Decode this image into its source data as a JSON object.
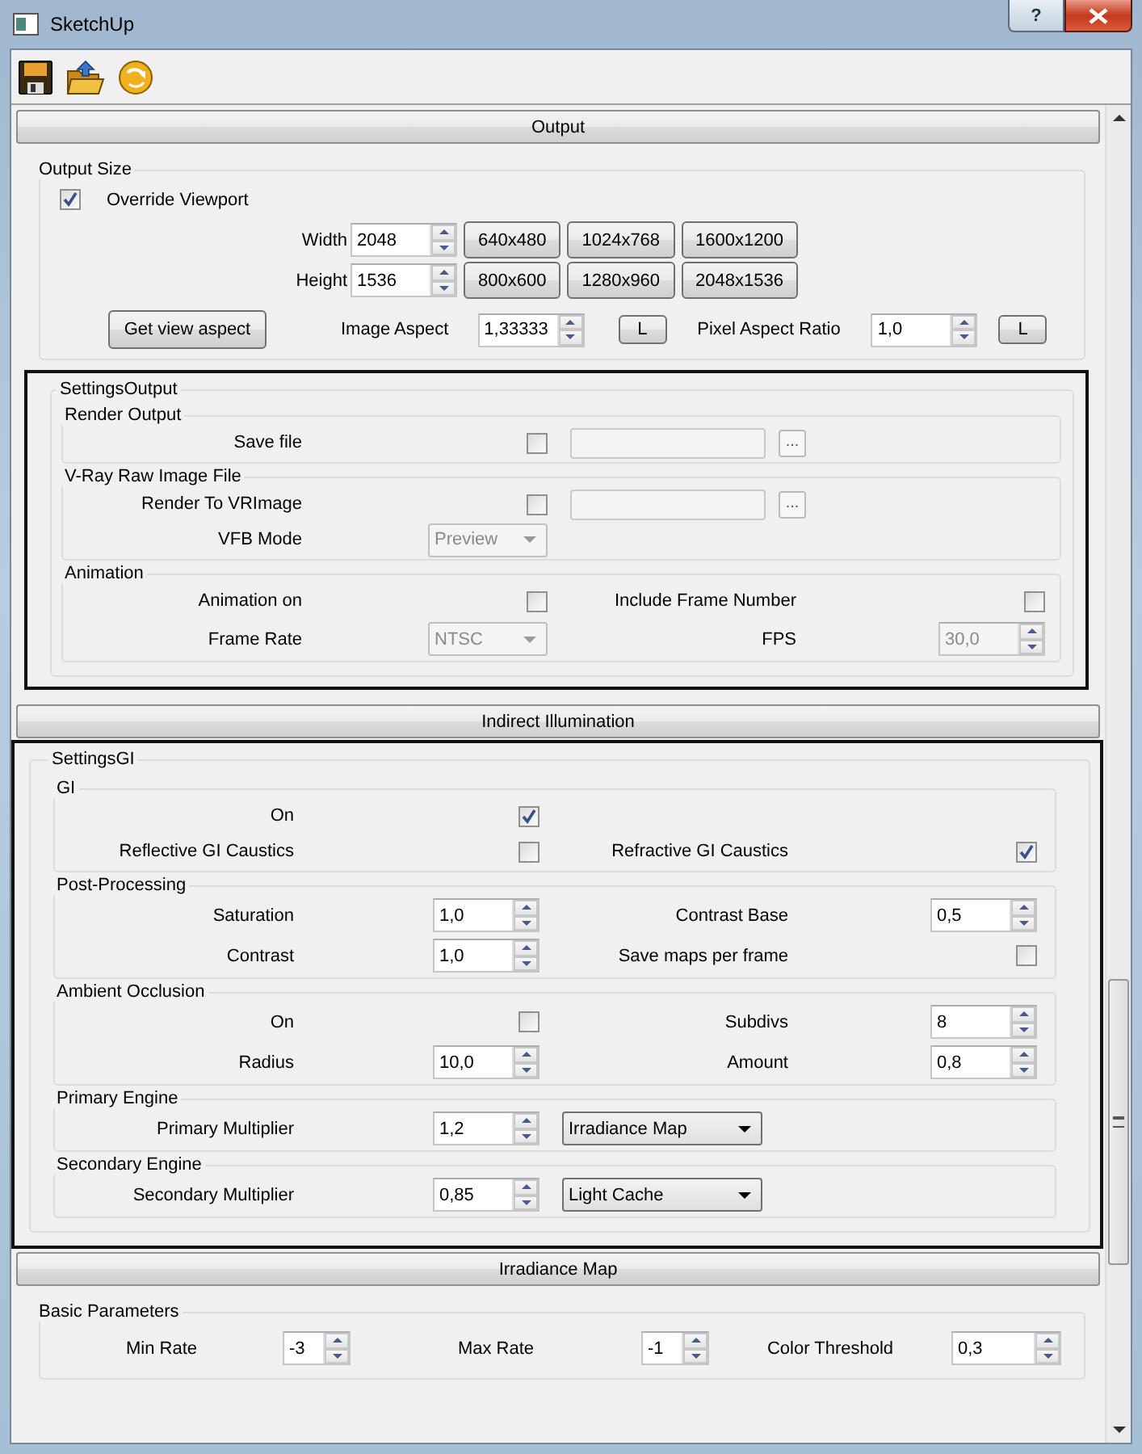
{
  "window": {
    "title": "SketchUp",
    "help_button": "?"
  },
  "toolbar": [
    {
      "kind": "save"
    },
    {
      "kind": "open"
    },
    {
      "kind": "refresh"
    }
  ],
  "sections": [
    {
      "title": "Output",
      "blocks": [
        {
          "kind": "group",
          "title": "Output Size",
          "rows": [
            {
              "kind": "check",
              "cells": [
                {
                  "kind": "checkbox",
                  "checked": true
                },
                {
                  "kind": "label",
                  "text": "Override Viewport"
                }
              ]
            },
            {
              "kind": "size",
              "cells": [
                {
                  "kind": "label",
                  "text": "Width"
                },
                {
                  "kind": "spin",
                  "value": "2048",
                  "disabled": false
                },
                {
                  "kind": "button",
                  "text": "640x480"
                },
                {
                  "kind": "button",
                  "text": "1024x768"
                },
                {
                  "kind": "button",
                  "text": "1600x1200"
                }
              ]
            },
            {
              "kind": "size",
              "cells": [
                {
                  "kind": "label",
                  "text": "Height"
                },
                {
                  "kind": "spin",
                  "value": "1536",
                  "disabled": false
                },
                {
                  "kind": "button",
                  "text": "800x600"
                },
                {
                  "kind": "button",
                  "text": "1280x960"
                },
                {
                  "kind": "button",
                  "text": "2048x1536"
                }
              ]
            },
            {
              "kind": "aspect",
              "cells": [
                {
                  "kind": "button",
                  "text": "Get view aspect"
                },
                {
                  "kind": "label",
                  "text": "Image Aspect"
                },
                {
                  "kind": "spin",
                  "value": "1,33333",
                  "disabled": false
                },
                {
                  "kind": "lock",
                  "text": "L"
                },
                {
                  "kind": "label",
                  "text": "Pixel Aspect Ratio"
                },
                {
                  "kind": "spin",
                  "value": "1,0",
                  "disabled": false
                },
                {
                  "kind": "lock",
                  "text": "L"
                }
              ]
            }
          ]
        },
        {
          "kind": "frame",
          "title": "SettingsOutput",
          "groups": [
            {
              "title": "Render Output",
              "rows": [
                {
                  "kind": "grid",
                  "cells": [
                    {
                      "kind": "label",
                      "text": "Save file"
                    },
                    {
                      "kind": "checkbox",
                      "checked": false
                    },
                    {
                      "kind": "file",
                      "browse": "..."
                    }
                  ]
                }
              ]
            },
            {
              "title": "V-Ray Raw Image File",
              "rows": [
                {
                  "kind": "grid",
                  "cells": [
                    {
                      "kind": "label",
                      "text": "Render To VRImage"
                    },
                    {
                      "kind": "checkbox",
                      "checked": false
                    },
                    {
                      "kind": "file",
                      "browse": "..."
                    }
                  ]
                },
                {
                  "kind": "grid",
                  "cells": [
                    {
                      "kind": "label",
                      "text": "VFB Mode"
                    },
                    {
                      "kind": "combo",
                      "value": "Preview",
                      "disabled": true
                    }
                  ]
                }
              ]
            },
            {
              "title": "Animation",
              "rows": [
                {
                  "kind": "grid",
                  "cells": [
                    {
                      "kind": "label",
                      "text": "Animation on"
                    },
                    {
                      "kind": "checkbox",
                      "checked": false
                    },
                    {
                      "kind": "label",
                      "text": "Include Frame Number"
                    },
                    {
                      "kind": "checkbox",
                      "checked": false
                    }
                  ]
                },
                {
                  "kind": "grid",
                  "cells": [
                    {
                      "kind": "label",
                      "text": "Frame Rate"
                    },
                    {
                      "kind": "combo",
                      "value": "NTSC",
                      "disabled": true
                    },
                    {
                      "kind": "label",
                      "text": "FPS"
                    },
                    {
                      "kind": "spin",
                      "value": "30,0",
                      "disabled": true
                    }
                  ]
                }
              ]
            }
          ]
        }
      ]
    },
    {
      "title": "Indirect Illumination",
      "blocks": [
        {
          "kind": "frame",
          "title": "SettingsGI",
          "groups": [
            {
              "title": "GI",
              "rows": [
                {
                  "kind": "grid",
                  "cells": [
                    {
                      "kind": "label",
                      "text": "On"
                    },
                    {
                      "kind": "checkbox",
                      "checked": true
                    }
                  ]
                },
                {
                  "kind": "grid",
                  "cells": [
                    {
                      "kind": "label",
                      "text": "Reflective GI Caustics"
                    },
                    {
                      "kind": "checkbox",
                      "checked": false
                    },
                    {
                      "kind": "label",
                      "text": "Refractive GI Caustics"
                    },
                    {
                      "kind": "checkbox",
                      "checked": true
                    }
                  ]
                }
              ]
            },
            {
              "title": "Post-Processing",
              "rows": [
                {
                  "kind": "grid",
                  "cells": [
                    {
                      "kind": "label",
                      "text": "Saturation"
                    },
                    {
                      "kind": "spin",
                      "value": "1,0",
                      "disabled": false
                    },
                    {
                      "kind": "label",
                      "text": "Contrast Base"
                    },
                    {
                      "kind": "spin",
                      "value": "0,5",
                      "disabled": false
                    }
                  ]
                },
                {
                  "kind": "grid",
                  "cells": [
                    {
                      "kind": "label",
                      "text": "Contrast"
                    },
                    {
                      "kind": "spin",
                      "value": "1,0",
                      "disabled": false
                    },
                    {
                      "kind": "label",
                      "text": "Save maps per frame"
                    },
                    {
                      "kind": "checkbox",
                      "checked": false
                    }
                  ]
                }
              ]
            },
            {
              "title": "Ambient Occlusion",
              "rows": [
                {
                  "kind": "grid",
                  "cells": [
                    {
                      "kind": "label",
                      "text": "On"
                    },
                    {
                      "kind": "checkbox",
                      "checked": false
                    },
                    {
                      "kind": "label",
                      "text": "Subdivs"
                    },
                    {
                      "kind": "spin",
                      "value": "8",
                      "disabled": false
                    }
                  ]
                },
                {
                  "kind": "grid",
                  "cells": [
                    {
                      "kind": "label",
                      "text": "Radius"
                    },
                    {
                      "kind": "spin",
                      "value": "10,0",
                      "disabled": false
                    },
                    {
                      "kind": "label",
                      "text": "Amount"
                    },
                    {
                      "kind": "spin",
                      "value": "0,8",
                      "disabled": false
                    }
                  ]
                }
              ]
            },
            {
              "title": "Primary Engine",
              "rows": [
                {
                  "kind": "grid",
                  "cells": [
                    {
                      "kind": "label",
                      "text": "Primary Multiplier"
                    },
                    {
                      "kind": "spin",
                      "value": "1,2",
                      "disabled": false
                    },
                    {
                      "kind": "combo",
                      "value": "Irradiance Map",
                      "disabled": false
                    }
                  ]
                }
              ]
            },
            {
              "title": "Secondary Engine",
              "rows": [
                {
                  "kind": "grid",
                  "cells": [
                    {
                      "kind": "label",
                      "text": "Secondary Multiplier"
                    },
                    {
                      "kind": "spin",
                      "value": "0,85",
                      "disabled": false
                    },
                    {
                      "kind": "combo",
                      "value": "Light Cache",
                      "disabled": false
                    }
                  ]
                }
              ]
            }
          ]
        }
      ]
    },
    {
      "title": "Irradiance Map",
      "blocks": [
        {
          "kind": "group",
          "title": "Basic Parameters",
          "rows": [
            {
              "kind": "triple",
              "cells": [
                {
                  "kind": "label",
                  "text": "Min Rate"
                },
                {
                  "kind": "spin",
                  "value": "-3",
                  "disabled": false
                },
                {
                  "kind": "label",
                  "text": "Max Rate"
                },
                {
                  "kind": "spin",
                  "value": "-1",
                  "disabled": false
                },
                {
                  "kind": "label",
                  "text": "Color Threshold"
                },
                {
                  "kind": "spin",
                  "value": "0,3",
                  "disabled": false
                }
              ]
            }
          ]
        }
      ]
    }
  ]
}
